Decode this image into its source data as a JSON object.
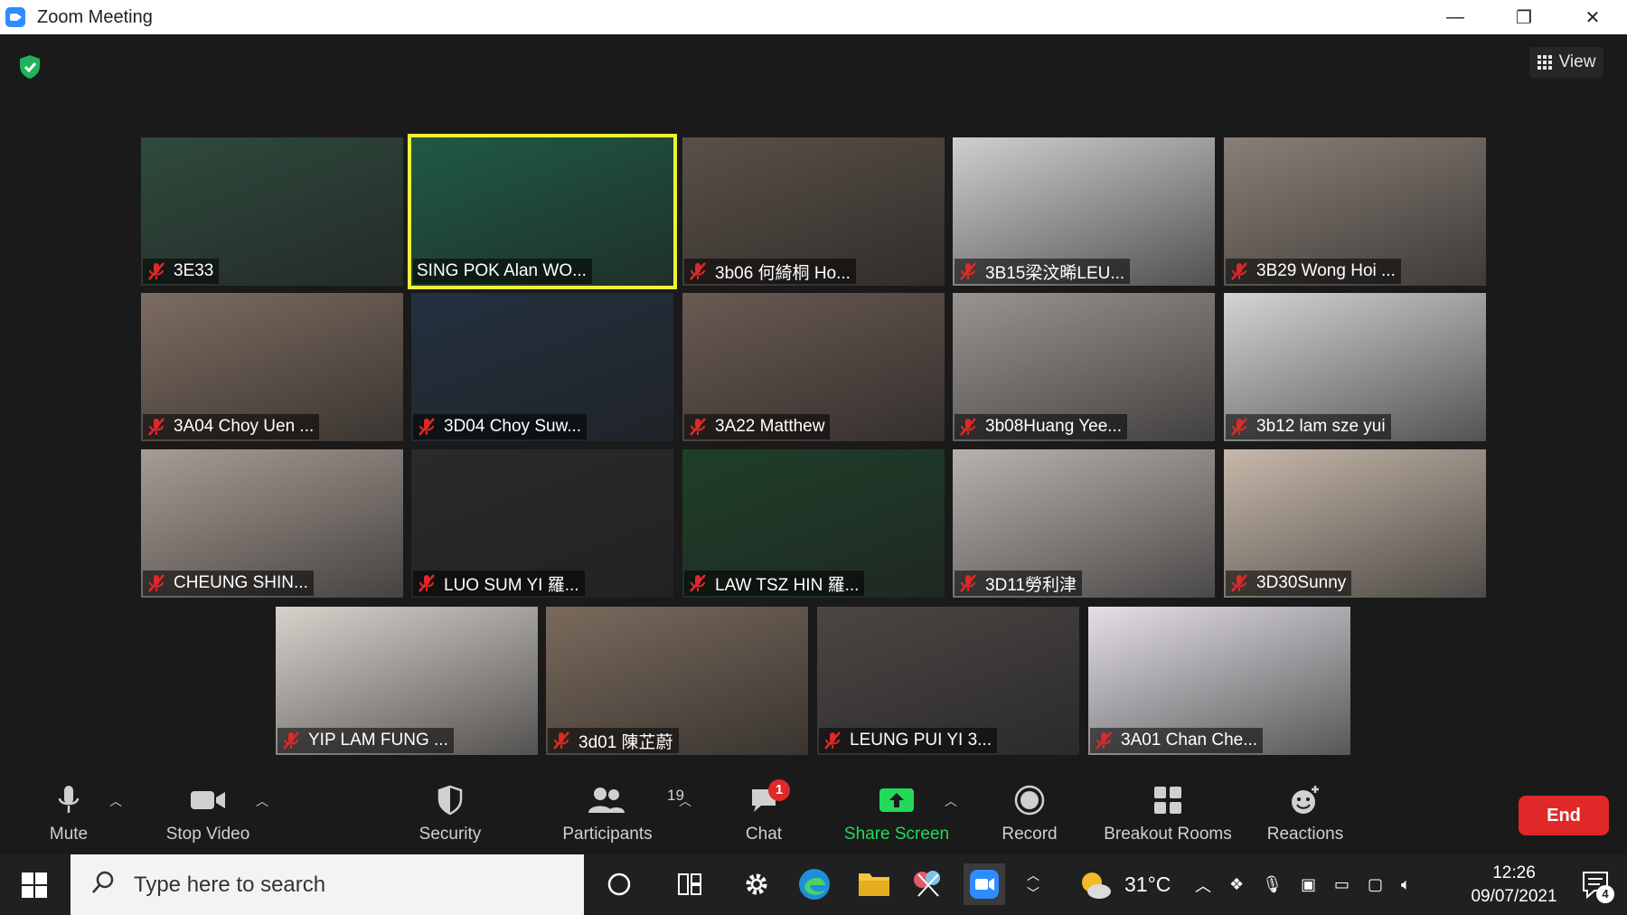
{
  "window": {
    "title": "Zoom Meeting",
    "minimize": "—",
    "restore": "❐",
    "close": "✕"
  },
  "meeting": {
    "view_label": "View",
    "participants": [
      {
        "name": "3E33",
        "muted": true,
        "bg": "#2f4a3d"
      },
      {
        "name": "SING POK Alan WO...",
        "muted": false,
        "active": true,
        "bg": "#1f5a44"
      },
      {
        "name": "3b06 何綺桐 Ho...",
        "muted": true,
        "bg": "#5a5048"
      },
      {
        "name": "3B15梁汶晞LEU...",
        "muted": true,
        "bg": "#cfcfcf"
      },
      {
        "name": "3B29 Wong Hoi ...",
        "muted": true,
        "bg": "#8a7f77"
      },
      {
        "name": "3A04 Choy Uen ...",
        "muted": true,
        "bg": "#7d6c60"
      },
      {
        "name": "3D04 Choy Suw...",
        "muted": true,
        "bg": "#23303f"
      },
      {
        "name": "3A22 Matthew",
        "muted": true,
        "bg": "#6a5a52"
      },
      {
        "name": "3b08Huang Yee...",
        "muted": true,
        "bg": "#9a9490"
      },
      {
        "name": "3b12 lam sze yui",
        "muted": true,
        "bg": "#d4d4d2"
      },
      {
        "name": "CHEUNG SHIN...",
        "muted": true,
        "bg": "#a89c94"
      },
      {
        "name": "LUO SUM YI 羅...",
        "muted": true,
        "bg": "#2a2a2a"
      },
      {
        "name": "LAW TSZ HIN 羅...",
        "muted": true,
        "bg": "#1f3f2a"
      },
      {
        "name": "3D11勞利津",
        "muted": true,
        "bg": "#b8b2ae"
      },
      {
        "name": "3D30Sunny",
        "muted": true,
        "bg": "#c7b8aa"
      },
      {
        "name": "YIP LAM FUNG ...",
        "muted": true,
        "bg": "#d8d2cc"
      },
      {
        "name": "3d01 陳芷蔚",
        "muted": true,
        "bg": "#7a6a5c"
      },
      {
        "name": "LEUNG PUI YI 3...",
        "muted": true,
        "bg": "#4a4644"
      },
      {
        "name": "3A01 Chan Che...",
        "muted": true,
        "bg": "#e4e0e6"
      }
    ]
  },
  "toolbar": {
    "mute": "Mute",
    "stop_video": "Stop Video",
    "security": "Security",
    "participants": "Participants",
    "participants_count": "19",
    "chat": "Chat",
    "chat_badge": "1",
    "share_screen": "Share Screen",
    "record": "Record",
    "breakout_rooms": "Breakout Rooms",
    "reactions": "Reactions",
    "end": "End",
    "share_color": "#23d959",
    "end_color": "#e02828"
  },
  "taskbar": {
    "search_placeholder": "Type here to search",
    "weather": "31°C",
    "time": "12:26",
    "date": "09/07/2021",
    "notifications": "4"
  }
}
